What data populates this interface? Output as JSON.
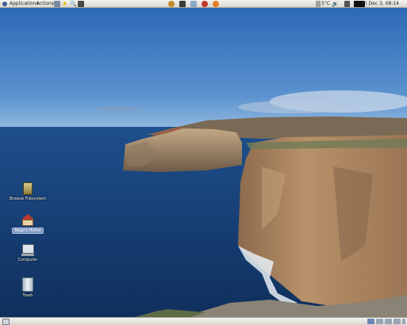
{
  "top_panel": {
    "menu_applications": "Applications",
    "menu_actions": "Actions",
    "weather": "5°C",
    "clock": "Fri Dec 3, 08:14"
  },
  "desktop_icons": [
    {
      "label": "Browse Filesystem",
      "icon": "filesystem-icon"
    },
    {
      "label": "Bego's Home",
      "icon": "home-folder-icon"
    },
    {
      "label": "Computer",
      "icon": "computer-icon"
    },
    {
      "label": "Trash",
      "icon": "trash-icon"
    }
  ],
  "colors": {
    "panel": "#e6e4de",
    "sky_top": "#2f6fba",
    "sea": "#143a6e",
    "cliff": "#a9825d",
    "selection": "#7d98c3"
  }
}
